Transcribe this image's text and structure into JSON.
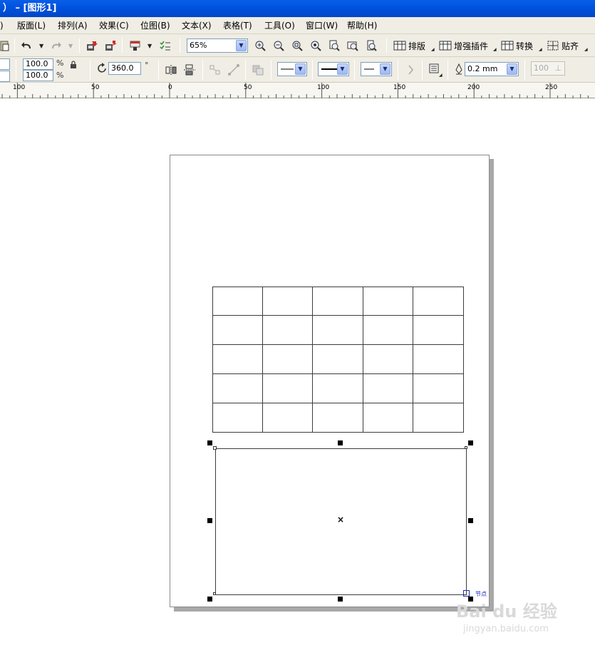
{
  "window": {
    "title": "）  –  [图形1]"
  },
  "menu": [
    {
      "label": ")"
    },
    {
      "label": "版面(L)"
    },
    {
      "label": "排列(A)"
    },
    {
      "label": "效果(C)"
    },
    {
      "label": "位图(B)"
    },
    {
      "label": "文本(X)"
    },
    {
      "label": "表格(T)"
    },
    {
      "label": "工具(O)"
    },
    {
      "label": "窗口(W)"
    },
    {
      "label": "帮助(H)"
    }
  ],
  "toolbar": {
    "zoom_value": "65%",
    "buttons": [
      {
        "label": "排版"
      },
      {
        "label": "增强插件"
      },
      {
        "label": "转换"
      },
      {
        "label": "贴齐"
      }
    ]
  },
  "property_bar": {
    "scale_x": "100.0",
    "scale_y": "100.0",
    "percent_sign": "%",
    "rotation": "360.0",
    "degree_sign": "°",
    "outline_width": "0.2 mm",
    "disabled_value": "100"
  },
  "ruler": {
    "labels": [
      "100",
      "50",
      "0",
      "50",
      "100",
      "150",
      "200",
      "250"
    ]
  },
  "table": {
    "rows": 5,
    "cols": 5
  },
  "selection": {
    "center_mark": "×",
    "node_label": "节点"
  },
  "watermark": {
    "line1": "Bai du 经验",
    "line2": "jingyan.baidu.com"
  },
  "colors": {
    "titlebar": "#0053e0",
    "chrome": "#efede4",
    "page_shadow": "#a8a8a8"
  }
}
